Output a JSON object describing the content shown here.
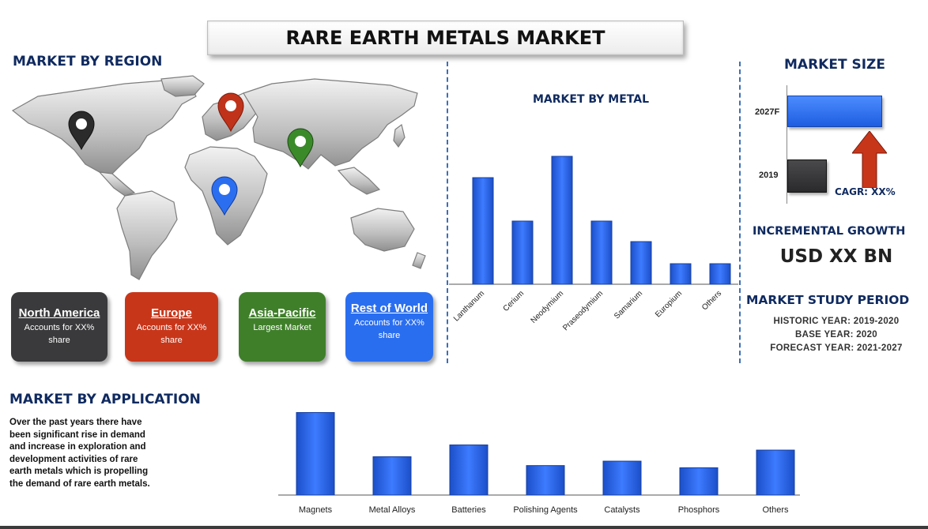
{
  "title": "RARE EARTH METALS MARKET",
  "region_section": {
    "heading": "MARKET BY REGION",
    "regions": [
      {
        "name": "North America",
        "desc": "Accounts for XX% share",
        "color": "#3a3a3c"
      },
      {
        "name": "Europe",
        "desc": "Accounts for XX% share",
        "color": "#c8361a"
      },
      {
        "name": "Asia-Pacific",
        "desc": "Largest Market",
        "color": "#3f7f2a"
      },
      {
        "name": "Rest of World",
        "desc": "Accounts for XX% share",
        "color": "#2a6ef0"
      }
    ],
    "pins": [
      {
        "region": "North America",
        "icon": "map-pin-icon",
        "color": "#2b2b2b"
      },
      {
        "region": "Europe",
        "icon": "map-pin-icon",
        "color": "#c0321a"
      },
      {
        "region": "Asia-Pacific",
        "icon": "map-pin-icon",
        "color": "#3b8a2a"
      },
      {
        "region": "Rest of World",
        "icon": "map-pin-icon",
        "color": "#2b6ff0"
      }
    ]
  },
  "metal_section": {
    "heading": "MARKET BY  METAL"
  },
  "size_section": {
    "heading": "MARKET SIZE",
    "bars": [
      {
        "label": "2027F",
        "color": "#2b6ff0"
      },
      {
        "label": "2019",
        "color": "#3a3a3c"
      }
    ],
    "cagr": "CAGR: XX%",
    "arrow_icon": "up-arrow-icon",
    "arrow_color": "#c8361a"
  },
  "growth": {
    "heading": "INCREMENTAL GROWTH",
    "value": "USD XX BN"
  },
  "study_period": {
    "heading": "MARKET STUDY PERIOD",
    "historic": "HISTORIC YEAR: 2019-2020",
    "base": "BASE YEAR: 2020",
    "forecast": "FORECAST YEAR: 2021-2027"
  },
  "application_section": {
    "heading": "MARKET BY APPLICATION",
    "description": "Over the past years there have been significant rise in demand and  increase in exploration and development activities of rare earth metals  which is propelling the demand of rare earth metals."
  },
  "colors": {
    "bar": "#2b5fe0",
    "heading": "#0f2a5f",
    "divider": "#3d6fb5"
  },
  "chart_data": [
    {
      "type": "bar",
      "categories": [
        "Lanthanum",
        "Cerium",
        "Neodymium",
        "Praseodymium",
        "Samarium",
        "Europium",
        "Others"
      ],
      "values": [
        135,
        80,
        162,
        80,
        54,
        26,
        26
      ],
      "ylim": [
        0,
        170
      ],
      "grid": false
    },
    {
      "type": "bar",
      "categories": [
        "Magnets",
        "Metal Alloys",
        "Batteries",
        "Polishing Agents",
        "Catalysts",
        "Phosphors",
        "Others"
      ],
      "values": [
        112,
        52,
        68,
        40,
        46,
        37,
        61
      ],
      "ylim": [
        0,
        120
      ],
      "grid": false
    }
  ]
}
